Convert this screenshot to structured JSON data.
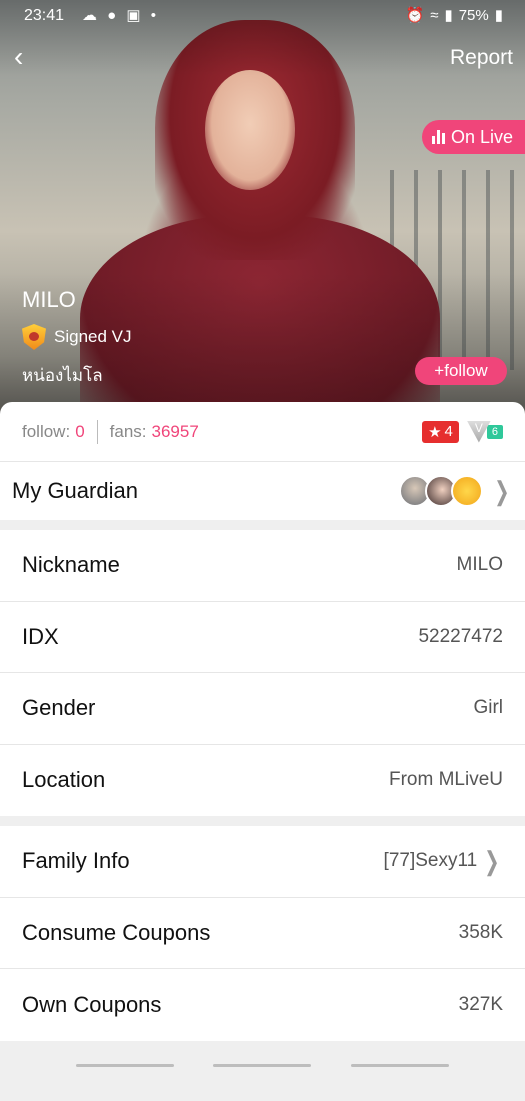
{
  "status": {
    "time": "23:41",
    "notif_icons": "☁ ● ▣ •",
    "battery": "75%"
  },
  "header": {
    "report_label": "Report",
    "live_label": "On Live"
  },
  "profile": {
    "name": "MILO",
    "verified_label": "Signed VJ",
    "bio": "หน่องไมโล",
    "follow_button": "+follow"
  },
  "stats": {
    "follow_label": "follow:",
    "follow_value": "0",
    "fans_label": "fans:",
    "fans_value": "36957",
    "level": "4",
    "vip_level": "6"
  },
  "guardian": {
    "label": "My Guardian"
  },
  "info": [
    {
      "label": "Nickname",
      "value": "MILO"
    },
    {
      "label": "IDX",
      "value": "52227472"
    },
    {
      "label": "Gender",
      "value": "Girl"
    },
    {
      "label": "Location",
      "value": "From MLiveU"
    }
  ],
  "extra": [
    {
      "label": "Family Info",
      "value": "[77]Sexy11"
    },
    {
      "label": "Consume Coupons",
      "value": "358K"
    },
    {
      "label": "Own Coupons",
      "value": "327K"
    }
  ],
  "colors": {
    "accent": "#f0457a",
    "level_red": "#e62e2e",
    "vip_green": "#2fc89a"
  }
}
